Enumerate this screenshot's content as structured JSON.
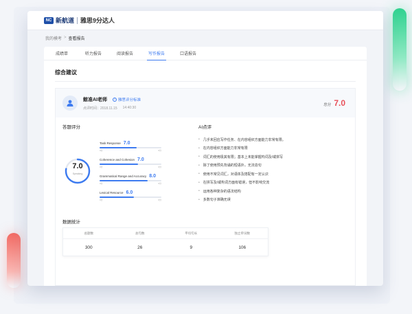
{
  "header": {
    "logo_text": "新航道",
    "app_title": "雅思9分达人"
  },
  "breadcrumb": {
    "parent": "我的模考",
    "separator": ">",
    "current": "查看报告"
  },
  "tabs": [
    {
      "label": "成绩单",
      "active": false
    },
    {
      "label": "听力报告",
      "active": false
    },
    {
      "label": "阅读报告",
      "active": false
    },
    {
      "label": "写作报告",
      "active": true
    },
    {
      "label": "口语报告",
      "active": false
    }
  ],
  "section_title": "综合建议",
  "teacher": {
    "name": "鲸准AI老师",
    "standard_link": "雅思评分标准",
    "review_time_label": "点评时间：2018.11.15",
    "review_time_clock": "14:40:30",
    "icon": "user-icon"
  },
  "total": {
    "label": "总分",
    "value": "7.0"
  },
  "score_section": {
    "title": "答题评分",
    "overall_score": "7.0",
    "overall_label": "Speaking",
    "overall_fraction": 0.78,
    "criteria": [
      {
        "name": "Task Response",
        "score": "7.0",
        "fraction": 0.6,
        "min": "0分",
        "max": "9分"
      },
      {
        "name": "Coherence and Cohesion",
        "score": "7.0",
        "fraction": 0.62,
        "min": "0分",
        "max": "9分"
      },
      {
        "name": "Grammatical Range and Accuracy",
        "score": "8.0",
        "fraction": 0.78,
        "min": "0分",
        "max": "9分"
      },
      {
        "name": "Lexical Resource",
        "score": "6.0",
        "fraction": 0.56,
        "min": "0分",
        "max": "9分"
      }
    ]
  },
  "ai_comments": {
    "title": "AI点评",
    "items": [
      "几乎未回应写作任务、在内容组织方面能力非常有限。",
      "在内容组织方面能力非常有限",
      "词汇的使用极其有限；基本上未能掌握构词及/或拼写",
      "除了使用预先背诵的短语外，无法造句",
      "使用不常见词汇，对语体及搭配有一定认识",
      "在拼写及/或构词方面有错误，但不影响交流",
      "运用各种复杂的语法结构",
      "多数句子准确无误"
    ]
  },
  "stats": {
    "title": "数据统计",
    "columns": [
      {
        "label": "总题数",
        "value": "300"
      },
      {
        "label": "总句数",
        "value": "26"
      },
      {
        "label": "平均句长",
        "value": "9"
      },
      {
        "label": "独立单词数",
        "value": "106"
      }
    ]
  },
  "colors": {
    "accent": "#3d7bf0",
    "total_score": "#e8515a",
    "ring_track": "#e4e8ef"
  }
}
